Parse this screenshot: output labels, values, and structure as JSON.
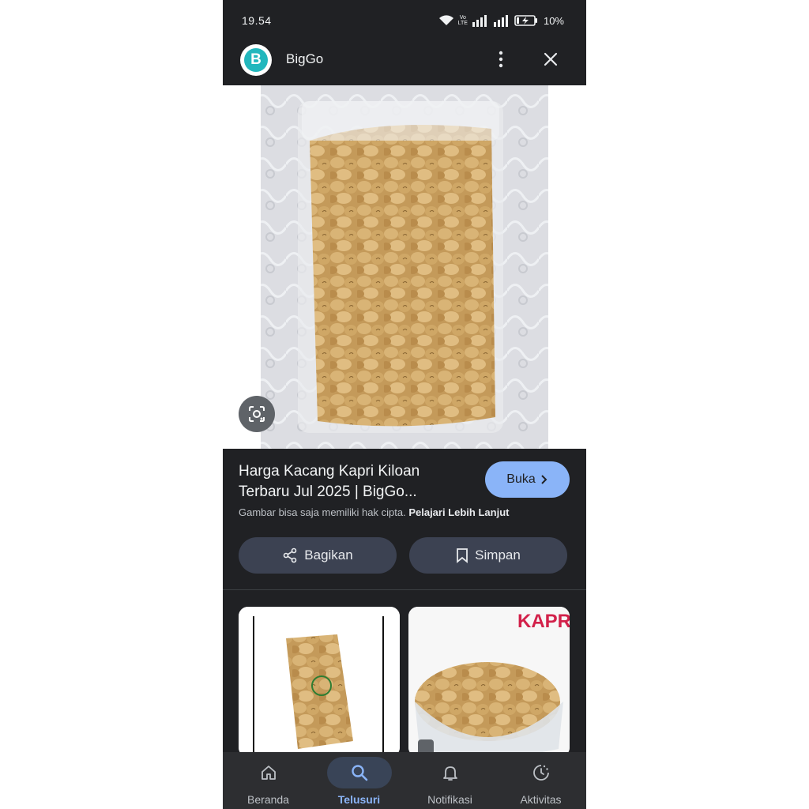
{
  "status_bar": {
    "time": "19.54",
    "volte_top": "Vo",
    "volte_bottom": "LTE",
    "battery": "10%"
  },
  "app_bar": {
    "logo_letter": "B",
    "title": "BigGo"
  },
  "result": {
    "title": "Harga Kacang Kapri Kiloan Terbaru Jul 2025 | BigGo...",
    "open_label": "Buka",
    "copyright_text": "Gambar bisa saja memiliki hak cipta.",
    "learn_more": "Pelajari Lebih Lanjut",
    "share_label": "Bagikan",
    "save_label": "Simpan"
  },
  "related": [
    {
      "overlay_text": ""
    },
    {
      "overlay_text": "KAPRI"
    }
  ],
  "bottom_nav": [
    {
      "label": "Beranda",
      "icon": "home-icon",
      "active": false
    },
    {
      "label": "Telusuri",
      "icon": "search-icon",
      "active": true
    },
    {
      "label": "Notifikasi",
      "icon": "bell-icon",
      "active": false
    },
    {
      "label": "Aktivitas",
      "icon": "activity-icon",
      "active": false
    }
  ],
  "colors": {
    "accent": "#8ab4f8",
    "background": "#202124",
    "nav_background": "#2d2e31",
    "button_background": "#3c4252",
    "logo": "#22b7bd",
    "kapri_text": "#d2214a"
  }
}
